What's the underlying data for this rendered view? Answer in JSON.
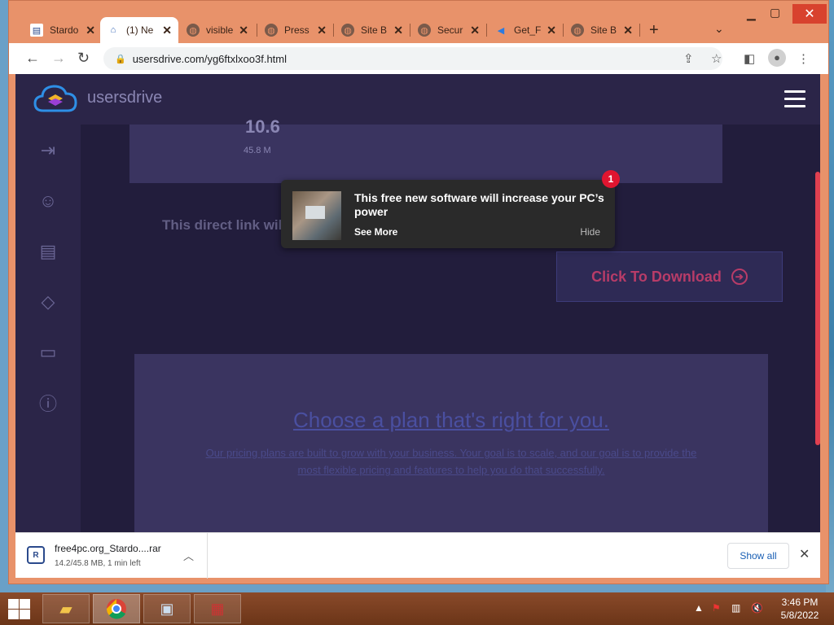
{
  "browser": {
    "tabs": [
      {
        "title": "Stardo",
        "icon": "page-icon",
        "active": false
      },
      {
        "title": "(1) Ne",
        "icon": "home-icon",
        "active": true
      },
      {
        "title": "visible",
        "icon": "globe-icon",
        "active": false
      },
      {
        "title": "Press",
        "icon": "globe-icon",
        "active": false
      },
      {
        "title": "Site B",
        "icon": "globe-icon",
        "active": false
      },
      {
        "title": "Secur",
        "icon": "globe-icon",
        "active": false
      },
      {
        "title": "Get_F",
        "icon": "fish-icon",
        "active": false
      },
      {
        "title": "Site B",
        "icon": "globe-icon",
        "active": false
      }
    ],
    "url": "usersdrive.com/yg6ftxlxoo3f.html"
  },
  "site": {
    "logo_text": "usersdrive",
    "file_size_partial": "45.8 M",
    "file_title_partial": "10.6",
    "direct_link_text": "This direct link will be available for your IP next6hours",
    "download_button": "Click To Download",
    "plans_heading": "Choose a plan that's right for you.",
    "plans_desc": "Our pricing plans are built to grow with your business. Your goal is to scale, and our goal is to provide the most flexible pricing and features to help you do that successfully."
  },
  "notification": {
    "title": "This free new software will increase your PC’s power",
    "see_more": "See More",
    "hide": "Hide",
    "badge_count": "1"
  },
  "downloads": {
    "filename": "free4pc.org_Stardo....rar",
    "status": "14.2/45.8 MB, 1 min left",
    "show_all": "Show all"
  },
  "taskbar": {
    "time": "3:46 PM",
    "date": "5/8/2022"
  },
  "colors": {
    "accent_download": "#b83c68",
    "page_bg": "#221d3c",
    "browser_frame": "#e8926a"
  }
}
